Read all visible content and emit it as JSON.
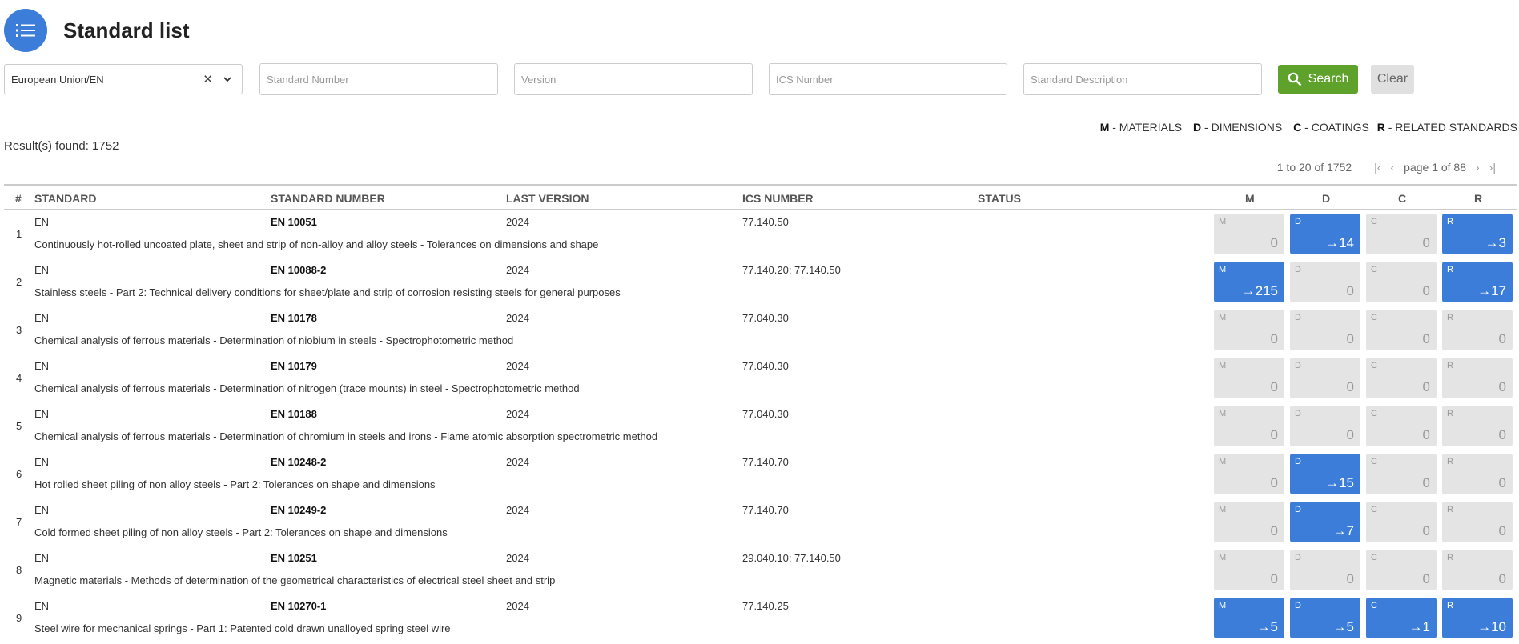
{
  "page": {
    "title": "Standard list"
  },
  "filters": {
    "region_value": "European Union/EN",
    "standard_number_placeholder": "Standard Number",
    "version_placeholder": "Version",
    "ics_placeholder": "ICS Number",
    "description_placeholder": "Standard Description",
    "search_label": "Search",
    "clear_label": "Clear"
  },
  "legend": [
    {
      "key": "M",
      "text": " - MATERIALS"
    },
    {
      "key": "D",
      "text": " - DIMENSIONS"
    },
    {
      "key": "C",
      "text": " - COATINGS"
    },
    {
      "key": "R",
      "text": " - RELATED STANDARDS"
    }
  ],
  "results_found": "Result(s) found: 1752",
  "pagination": {
    "range": "1 to  20 of  1752",
    "page_text": "page 1 of 88"
  },
  "columns": {
    "num": "#",
    "standard": "STANDARD",
    "standard_number": "STANDARD NUMBER",
    "last_version": "LAST VERSION",
    "ics_number": "ICS NUMBER",
    "status": "STATUS",
    "m": "M",
    "d": "D",
    "c": "C",
    "r": "R"
  },
  "colors": {
    "accent": "#3b7dd8",
    "search": "#5ea22c",
    "inactive_box": "#e4e4e4"
  },
  "rows": [
    {
      "num": "1",
      "standard": "EN",
      "number": "EN 10051",
      "version": "2024",
      "ics": "77.140.50",
      "desc": "Continuously hot-rolled uncoated plate, sheet and strip of non-alloy and alloy steels - Tolerances on dimensions and shape",
      "m": {
        "label": "M",
        "value": "0",
        "active": false
      },
      "d": {
        "label": "D",
        "value": "→14",
        "active": true
      },
      "c": {
        "label": "C",
        "value": "0",
        "active": false
      },
      "r": {
        "label": "R",
        "value": "→3",
        "active": true
      }
    },
    {
      "num": "2",
      "standard": "EN",
      "number": "EN 10088-2",
      "version": "2024",
      "ics": "77.140.20; 77.140.50",
      "desc": "Stainless steels - Part 2: Technical delivery conditions for sheet/plate and strip of corrosion resisting steels for general purposes",
      "m": {
        "label": "M",
        "value": "→215",
        "active": true
      },
      "d": {
        "label": "D",
        "value": "0",
        "active": false
      },
      "c": {
        "label": "C",
        "value": "0",
        "active": false
      },
      "r": {
        "label": "R",
        "value": "→17",
        "active": true
      }
    },
    {
      "num": "3",
      "standard": "EN",
      "number": "EN 10178",
      "version": "2024",
      "ics": "77.040.30",
      "desc": "Chemical analysis of ferrous materials - Determination of niobium in steels - Spectrophotometric method",
      "m": {
        "label": "M",
        "value": "0",
        "active": false
      },
      "d": {
        "label": "D",
        "value": "0",
        "active": false
      },
      "c": {
        "label": "C",
        "value": "0",
        "active": false
      },
      "r": {
        "label": "R",
        "value": "0",
        "active": false
      }
    },
    {
      "num": "4",
      "standard": "EN",
      "number": "EN 10179",
      "version": "2024",
      "ics": "77.040.30",
      "desc": "Chemical analysis of ferrous materials - Determination of nitrogen (trace mounts) in steel - Spectrophotometric method",
      "m": {
        "label": "M",
        "value": "0",
        "active": false
      },
      "d": {
        "label": "D",
        "value": "0",
        "active": false
      },
      "c": {
        "label": "C",
        "value": "0",
        "active": false
      },
      "r": {
        "label": "R",
        "value": "0",
        "active": false
      }
    },
    {
      "num": "5",
      "standard": "EN",
      "number": "EN 10188",
      "version": "2024",
      "ics": "77.040.30",
      "desc": "Chemical analysis of ferrous materials - Determination of chromium in steels and irons - Flame atomic absorption spectrometric method",
      "m": {
        "label": "M",
        "value": "0",
        "active": false
      },
      "d": {
        "label": "D",
        "value": "0",
        "active": false
      },
      "c": {
        "label": "C",
        "value": "0",
        "active": false
      },
      "r": {
        "label": "R",
        "value": "0",
        "active": false
      }
    },
    {
      "num": "6",
      "standard": "EN",
      "number": "EN 10248-2",
      "version": "2024",
      "ics": "77.140.70",
      "desc": "Hot rolled sheet piling of non alloy steels - Part 2: Tolerances on shape and dimensions",
      "m": {
        "label": "M",
        "value": "0",
        "active": false
      },
      "d": {
        "label": "D",
        "value": "→15",
        "active": true
      },
      "c": {
        "label": "C",
        "value": "0",
        "active": false
      },
      "r": {
        "label": "R",
        "value": "0",
        "active": false
      }
    },
    {
      "num": "7",
      "standard": "EN",
      "number": "EN 10249-2",
      "version": "2024",
      "ics": "77.140.70",
      "desc": "Cold formed sheet piling of non alloy steels - Part 2: Tolerances on shape and dimensions",
      "m": {
        "label": "M",
        "value": "0",
        "active": false
      },
      "d": {
        "label": "D",
        "value": "→7",
        "active": true
      },
      "c": {
        "label": "C",
        "value": "0",
        "active": false
      },
      "r": {
        "label": "R",
        "value": "0",
        "active": false
      }
    },
    {
      "num": "8",
      "standard": "EN",
      "number": "EN 10251",
      "version": "2024",
      "ics": "29.040.10; 77.140.50",
      "desc": "Magnetic materials - Methods of determination of the geometrical characteristics of electrical steel sheet and strip",
      "m": {
        "label": "M",
        "value": "0",
        "active": false
      },
      "d": {
        "label": "D",
        "value": "0",
        "active": false
      },
      "c": {
        "label": "C",
        "value": "0",
        "active": false
      },
      "r": {
        "label": "R",
        "value": "0",
        "active": false
      }
    },
    {
      "num": "9",
      "standard": "EN",
      "number": "EN 10270-1",
      "version": "2024",
      "ics": "77.140.25",
      "desc": "Steel wire for mechanical springs - Part 1: Patented cold drawn unalloyed spring steel wire",
      "m": {
        "label": "M",
        "value": "→5",
        "active": true
      },
      "d": {
        "label": "D",
        "value": "→5",
        "active": true
      },
      "c": {
        "label": "C",
        "value": "→1",
        "active": true
      },
      "r": {
        "label": "R",
        "value": "→10",
        "active": true
      }
    }
  ]
}
